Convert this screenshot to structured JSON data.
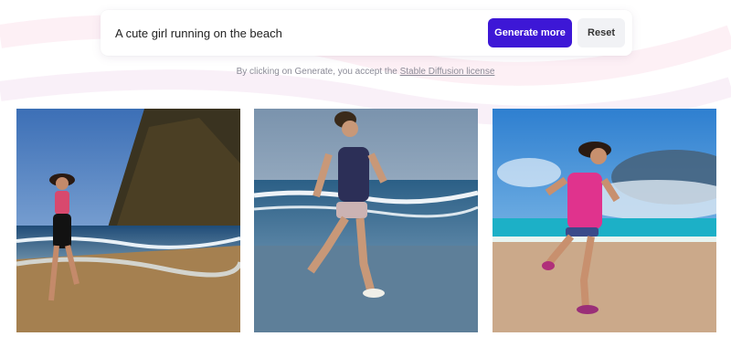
{
  "prompt": {
    "value": "A cute girl running on the beach",
    "generate_label": "Generate more",
    "reset_label": "Reset"
  },
  "license": {
    "prefix": "By clicking on Generate, you accept the ",
    "link": "Stable Diffusion license"
  },
  "images": [
    {
      "scene": "girl running on shoreline beside dark cliff"
    },
    {
      "scene": "girl running toward camera in shallow surf"
    },
    {
      "scene": "girl in pink top running on sunny beach"
    }
  ],
  "colors": {
    "accent": "#3d17d6",
    "reset_bg": "#f1f2f5",
    "muted_text": "#8b8b97"
  }
}
